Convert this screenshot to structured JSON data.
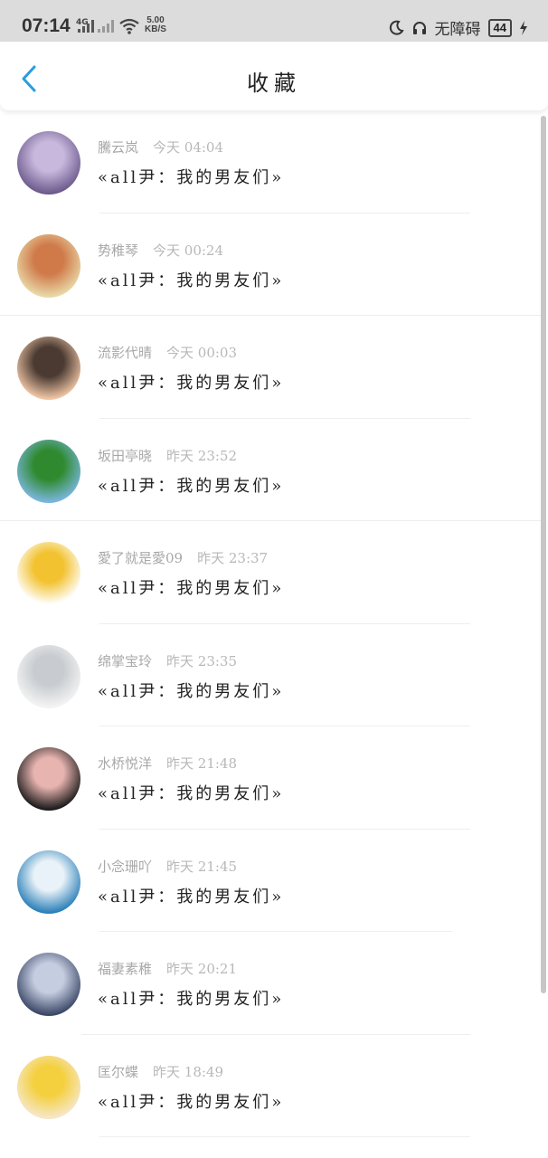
{
  "status_bar": {
    "time": "07:14",
    "network": "4G",
    "speed_value": "5.00",
    "speed_unit": "KB/S",
    "accessibility": "无障碍",
    "battery": "44"
  },
  "header": {
    "title": "收藏"
  },
  "favorites": [
    {
      "user": "騰云岚",
      "time": "今天 04:04",
      "message": "«all尹：我的男友们»",
      "avatar_colors": [
        "#6b5a8c",
        "#c9b8dd"
      ]
    },
    {
      "user": "势稚琴",
      "time": "今天 00:24",
      "message": "«all尹：我的男友们»",
      "avatar_colors": [
        "#e9d9a8",
        "#d07a4a"
      ]
    },
    {
      "user": "流影代晴",
      "time": "今天 00:03",
      "message": "«all尹：我的男友们»",
      "avatar_colors": [
        "#f1c6a6",
        "#4a3a32"
      ]
    },
    {
      "user": "坂田亭晓",
      "time": "昨天 23:52",
      "message": "«all尹：我的男友们»",
      "avatar_colors": [
        "#7ab6dd",
        "#2f8a2f"
      ]
    },
    {
      "user": "愛了就是愛09",
      "time": "昨天 23:37",
      "message": "«all尹：我的男友们»",
      "avatar_colors": [
        "#ffffff",
        "#f2c230"
      ]
    },
    {
      "user": "绵掌宝玲",
      "time": "昨天 23:35",
      "message": "«all尹：我的男友们»",
      "avatar_colors": [
        "#f4f4f4",
        "#c8ccd0"
      ]
    },
    {
      "user": "水桥悦洋",
      "time": "昨天 21:48",
      "message": "«all尹：我的男友们»",
      "avatar_colors": [
        "#1a1a1a",
        "#e8b4b0"
      ]
    },
    {
      "user": "小念珊吖",
      "time": "昨天 21:45",
      "message": "«all尹：我的男友们»",
      "avatar_colors": [
        "#2a7fb8",
        "#e9f2f8"
      ]
    },
    {
      "user": "福妻素稚",
      "time": "昨天 20:21",
      "message": "«all尹：我的男友们»",
      "avatar_colors": [
        "#3a4666",
        "#c5cde0"
      ]
    },
    {
      "user": "匡尔蝶",
      "time": "昨天 18:49",
      "message": "«all尹：我的男友们»",
      "avatar_colors": [
        "#f6e7c9",
        "#f4d03f"
      ]
    }
  ]
}
